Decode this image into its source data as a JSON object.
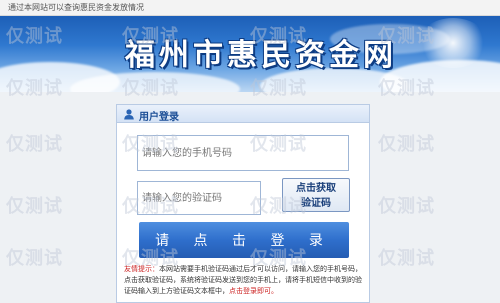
{
  "topbar": {
    "text": "通过本网站可以查询惠民资金发放情况"
  },
  "banner": {
    "title": "福州市惠民资金网"
  },
  "login": {
    "title": "用户登录",
    "phone_placeholder": "请输入您的手机号码",
    "code_placeholder": "请输入您的验证码",
    "get_code_line1": "点击获取",
    "get_code_line2": "验证码",
    "submit_label": "请 点 击 登 录",
    "tip_label": "友情提示：",
    "tip_text": "本网站需要手机验证码通过后才可以访问，请输入您的手机号码，点击获取验证码，系统将验证码发送到您的手机上，请将手机短信中收到的验证码输入到上方验证码文本框中，",
    "tip_emphasis": "点击登录即可。"
  },
  "watermark": {
    "text": "仅测试"
  },
  "colors": {
    "banner_blue": "#2f78cf",
    "button_blue": "#2f6fcc",
    "tip_red": "#cc2222"
  }
}
